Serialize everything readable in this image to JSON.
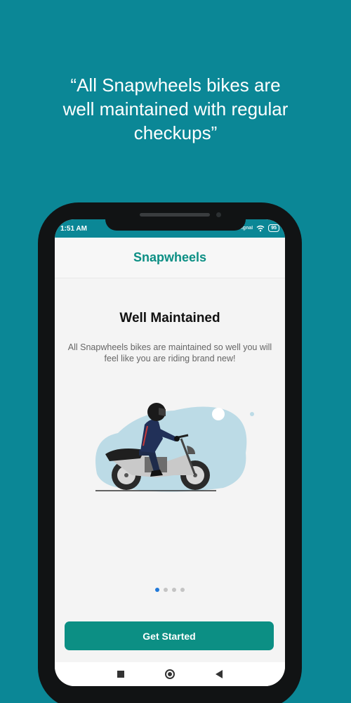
{
  "headline": {
    "line1": "“All Snapwheels bikes are",
    "line2": "well maintained with regular",
    "line3": "checkups”"
  },
  "status_bar": {
    "time": "1:51 AM",
    "signal": "Signal",
    "battery": "95"
  },
  "app": {
    "title": "Snapwheels"
  },
  "slide": {
    "title": "Well Maintained",
    "description": "All Snapwheels bikes are maintained so well you will feel like you are riding brand new!",
    "current_index": 0,
    "total": 4
  },
  "cta": {
    "label": "Get Started"
  },
  "nav": {
    "icons": [
      "recents-square-icon",
      "home-circle-icon",
      "back-triangle-icon"
    ]
  },
  "colors": {
    "background": "#0b8796",
    "accent": "#0c8f84",
    "active_dot": "#2079d9"
  }
}
